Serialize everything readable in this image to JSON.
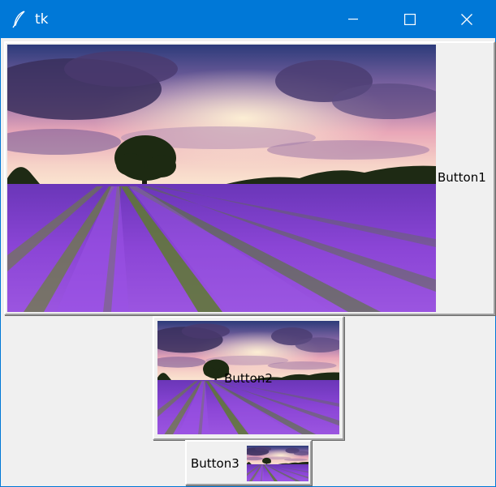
{
  "window": {
    "title": "tk",
    "titlebar_color": "#0078d7",
    "controls": [
      "minimize-icon",
      "maximize-icon",
      "close-icon"
    ]
  },
  "buttons": [
    {
      "label": "Button1",
      "compound": "right",
      "image": "lavender-field-landscape"
    },
    {
      "label": "Button2",
      "compound": "center",
      "image": "lavender-field-landscape"
    },
    {
      "label": "Button3",
      "compound": "left",
      "image": "lavender-field-landscape"
    }
  ],
  "colors": {
    "background": "#f0f0f0",
    "sky_top": "#2c3b7a",
    "sunset_glow": "#f3c9c6",
    "lavender": "#8b45d6",
    "tree": "#1d2a12"
  }
}
